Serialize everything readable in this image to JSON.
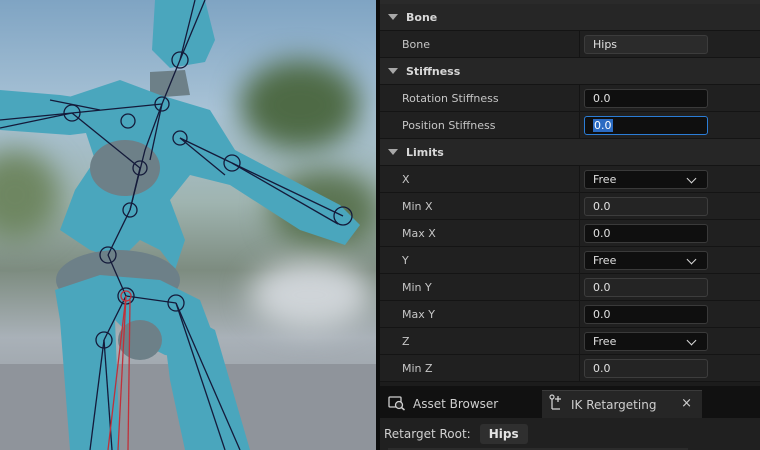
{
  "details": {
    "bone_section": "Bone",
    "bone_label": "Bone",
    "bone_value": "Hips",
    "stiffness_section": "Stiffness",
    "rotation_stiffness_label": "Rotation Stiffness",
    "rotation_stiffness_value": "0.0",
    "position_stiffness_label": "Position Stiffness",
    "position_stiffness_value": "0.0",
    "limits_section": "Limits",
    "limits": [
      {
        "label": "X",
        "value": "Free",
        "kind": "dropdown"
      },
      {
        "label": "Min X",
        "value": "0.0",
        "kind": "dim"
      },
      {
        "label": "Max X",
        "value": "0.0",
        "kind": "field"
      },
      {
        "label": "Y",
        "value": "Free",
        "kind": "dropdown"
      },
      {
        "label": "Min Y",
        "value": "0.0",
        "kind": "dim"
      },
      {
        "label": "Max Y",
        "value": "0.0",
        "kind": "field"
      },
      {
        "label": "Z",
        "value": "Free",
        "kind": "dropdown"
      },
      {
        "label": "Min Z",
        "value": "0.0",
        "kind": "dim"
      }
    ]
  },
  "tabs": [
    {
      "label": "Asset Browser",
      "icon": "asset-browser-icon"
    },
    {
      "label": "IK Retargeting",
      "icon": "ik-retargeting-icon",
      "active": true
    }
  ],
  "close_glyph": "×",
  "retarget_root_label": "Retarget Root:",
  "retarget_root_value": "Hips",
  "colors": {
    "character": "#4aa6bd",
    "skeleton": "#141a3a",
    "selected_bone": "#c0303a",
    "focus": "#2b7dd6"
  }
}
